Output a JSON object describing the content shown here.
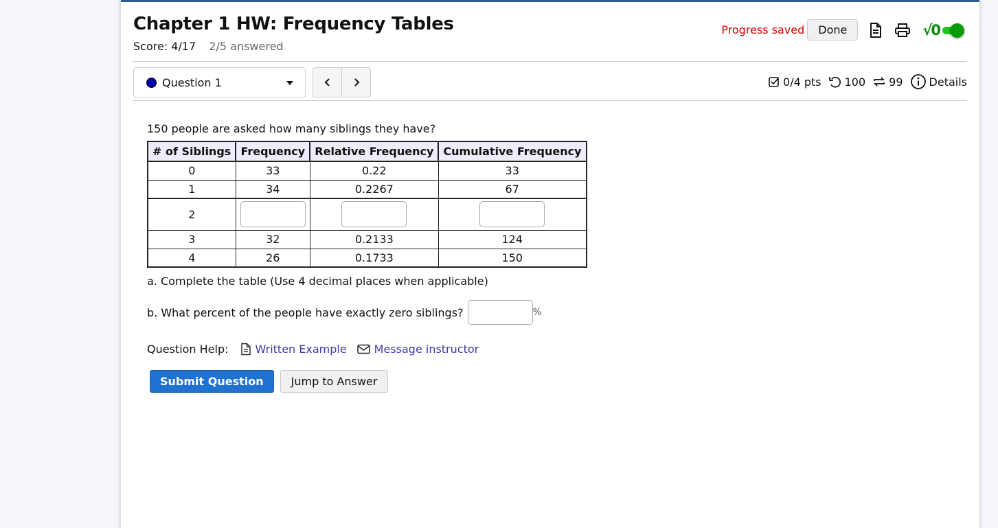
{
  "header": {
    "title": "Chapter 1 HW: Frequency Tables",
    "score": "Score: 4/17",
    "answered": "2/5 answered",
    "progress_status": "Progress saved",
    "done_label": "Done",
    "sqrt_label": "√0",
    "toggle_on": true,
    "icons": [
      "document-icon",
      "print-icon",
      "math-toggle"
    ]
  },
  "question_nav": {
    "selected_question": "Question 1",
    "status_dot_color": "#0000a8",
    "prev_label": "‹",
    "next_label": "›"
  },
  "meta": {
    "points": "0/4 pts",
    "attempts": "100",
    "retries": "99",
    "details_label": "Details"
  },
  "question": {
    "prompt": "150 people are asked how many siblings they have?",
    "table": {
      "headers": [
        "# of Siblings",
        "Frequency",
        "Relative Frequency",
        "Cumulative Frequency"
      ],
      "rows": [
        [
          "0",
          "33",
          "0.22",
          "33"
        ],
        [
          "1",
          "34",
          "0.2267",
          "67"
        ],
        [
          "2",
          "",
          "",
          ""
        ],
        [
          "3",
          "32",
          "0.2133",
          "124"
        ],
        [
          "4",
          "26",
          "0.1733",
          "150"
        ]
      ]
    },
    "part_a": "a. Complete the table (Use 4 decimal places when applicable)",
    "part_b": "b.  What percent of the people have exactly zero siblings?",
    "part_b_value": "",
    "percent_sign": "%"
  },
  "help": {
    "label": "Question Help:",
    "written_example": "Written Example",
    "message_instructor": "Message instructor"
  },
  "actions": {
    "submit_label": "Submit Question",
    "jump_label": "Jump to Answer"
  },
  "colors": {
    "accent": "#1f72d1",
    "progress_saved": "#d40000",
    "link": "#3a3aa8",
    "toggle": "#0a9a0a",
    "header_bar": "#2f5e8c"
  }
}
